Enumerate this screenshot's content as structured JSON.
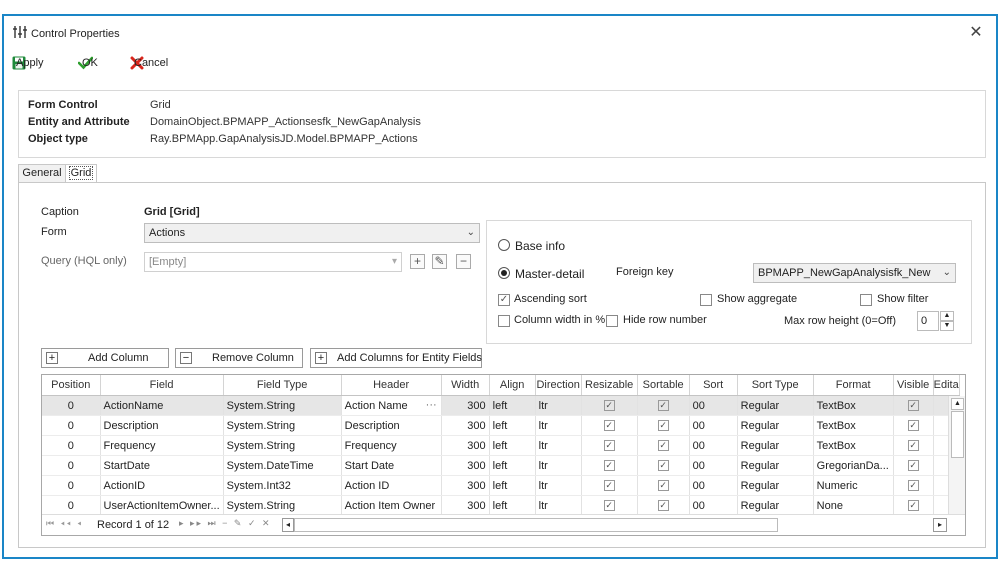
{
  "window": {
    "title": "Control Properties"
  },
  "toolbar": {
    "apply": "Apply",
    "ok": "OK",
    "cancel": "Cancel"
  },
  "info": {
    "form_control_label": "Form Control",
    "form_control_value": "Grid",
    "entity_label": "Entity and Attribute",
    "entity_value": "DomainObject.BPMAPP_Actionsesfk_NewGapAnalysis",
    "object_type_label": "Object type",
    "object_type_value": "Ray.BPMApp.GapAnalysisJD.Model.BPMAPP_Actions"
  },
  "tabs": [
    {
      "label": "General"
    },
    {
      "label": "Grid"
    }
  ],
  "grid_props": {
    "caption_label": "Caption",
    "caption_value": "Grid [Grid]",
    "form_label": "Form",
    "form_value": "Actions",
    "query_label": "Query (HQL only)",
    "query_value": "[Empty]",
    "base_info": "Base info",
    "master_detail": "Master-detail",
    "foreign_key_label": "Foreign key",
    "foreign_key_value": "BPMAPP_NewGapAnalysisfk_New",
    "ascending_sort": "Ascending sort",
    "show_aggregate": "Show aggregate",
    "show_filter": "Show filter",
    "column_width": "Column width in %",
    "hide_row_number": "Hide row number",
    "max_row_height_label": "Max row height (0=Off)",
    "max_row_height_value": "0"
  },
  "grid_buttons": {
    "add_column": "Add Column",
    "remove_column": "Remove Column",
    "add_entity_fields": "Add Columns for Entity Fields"
  },
  "columns": [
    "Position",
    "Field",
    "Field Type",
    "Header",
    "Width",
    "Align",
    "Direction",
    "Resizable",
    "Sortable",
    "Sort",
    "Sort Type",
    "Format",
    "Visible",
    "Edita"
  ],
  "rows": [
    {
      "position": "0",
      "field": "ActionName",
      "type": "System.String",
      "header": "Action Name",
      "width": "300",
      "align": "left",
      "direction": "ltr",
      "sort": "00",
      "sort_type": "Regular",
      "format": "TextBox"
    },
    {
      "position": "0",
      "field": "Description",
      "type": "System.String",
      "header": "Description",
      "width": "300",
      "align": "left",
      "direction": "ltr",
      "sort": "00",
      "sort_type": "Regular",
      "format": "TextBox"
    },
    {
      "position": "0",
      "field": "Frequency",
      "type": "System.String",
      "header": "Frequency",
      "width": "300",
      "align": "left",
      "direction": "ltr",
      "sort": "00",
      "sort_type": "Regular",
      "format": "TextBox"
    },
    {
      "position": "0",
      "field": "StartDate",
      "type": "System.DateTime",
      "header": "Start Date",
      "width": "300",
      "align": "left",
      "direction": "ltr",
      "sort": "00",
      "sort_type": "Regular",
      "format": "GregorianDa..."
    },
    {
      "position": "0",
      "field": "ActionID",
      "type": "System.Int32",
      "header": "Action ID",
      "width": "300",
      "align": "left",
      "direction": "ltr",
      "sort": "00",
      "sort_type": "Regular",
      "format": "Numeric"
    },
    {
      "position": "0",
      "field": "UserActionItemOwner...",
      "type": "System.String",
      "header": "Action Item Owner",
      "width": "300",
      "align": "left",
      "direction": "ltr",
      "sort": "00",
      "sort_type": "Regular",
      "format": "None"
    }
  ],
  "navigator": {
    "record_text": "Record 1 of 12"
  },
  "colors": {
    "frame": "#1a86c7",
    "apply_icon": "#1e8a3a",
    "ok_icon": "#2e9e2e",
    "cancel_icon": "#d9261c"
  }
}
